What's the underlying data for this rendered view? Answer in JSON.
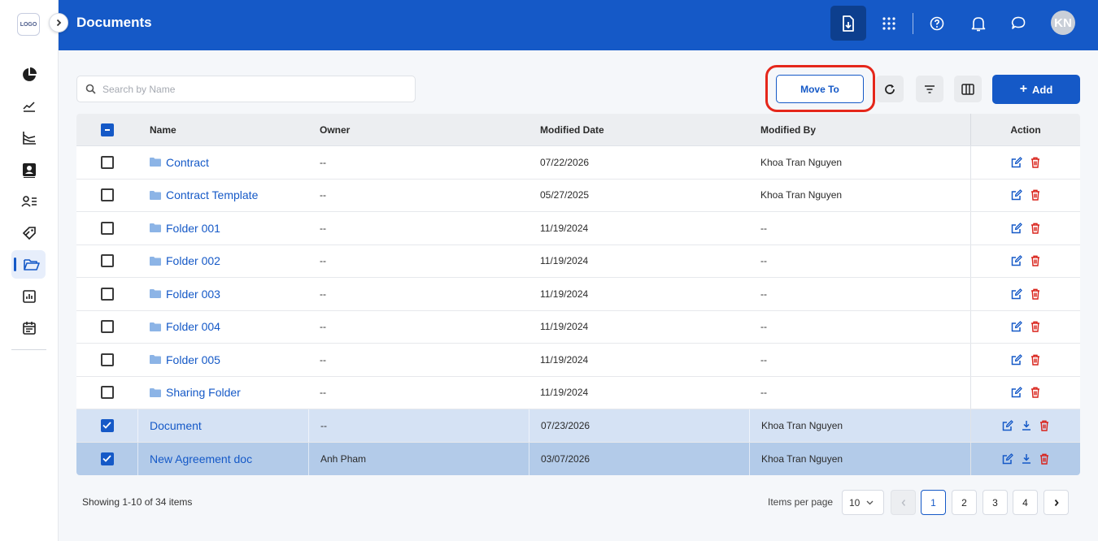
{
  "app": {
    "logo_text": "LOGO",
    "page_title": "Documents",
    "avatar_initials": "KN"
  },
  "colors": {
    "brand": "#1559c7",
    "danger": "#d9221a",
    "highlight_ring": "#e5271b"
  },
  "sidebar": {
    "items": [
      {
        "icon": "pie-chart-icon"
      },
      {
        "icon": "trend-line-icon"
      },
      {
        "icon": "chart-axes-icon"
      },
      {
        "icon": "contact-card-icon"
      },
      {
        "icon": "user-list-icon"
      },
      {
        "icon": "tags-icon"
      },
      {
        "icon": "folder-open-icon",
        "active": true
      },
      {
        "icon": "bar-report-icon"
      },
      {
        "icon": "calendar-icon"
      }
    ]
  },
  "topbar": {
    "icons": [
      "download-doc-icon",
      "apps-grid-icon",
      "help-icon",
      "bell-icon",
      "chat-icon"
    ]
  },
  "toolbar": {
    "search_placeholder": "Search by Name",
    "move_to_label": "Move To",
    "add_label": "Add",
    "icons": [
      "refresh-icon",
      "filter-icon",
      "columns-icon"
    ]
  },
  "table": {
    "headers": {
      "name": "Name",
      "owner": "Owner",
      "modified_date": "Modified Date",
      "modified_by": "Modified By",
      "action": "Action"
    },
    "rows": [
      {
        "name": "Contract",
        "type": "folder",
        "owner": "--",
        "modified_date": "07/22/2026",
        "modified_by": "Khoa Tran Nguyen",
        "checked": false
      },
      {
        "name": "Contract Template",
        "type": "folder",
        "owner": "--",
        "modified_date": "05/27/2025",
        "modified_by": "Khoa Tran Nguyen",
        "checked": false
      },
      {
        "name": "Folder 001",
        "type": "folder",
        "owner": "--",
        "modified_date": "11/19/2024",
        "modified_by": "--",
        "checked": false
      },
      {
        "name": "Folder 002",
        "type": "folder",
        "owner": "--",
        "modified_date": "11/19/2024",
        "modified_by": "--",
        "checked": false
      },
      {
        "name": "Folder 003",
        "type": "folder",
        "owner": "--",
        "modified_date": "11/19/2024",
        "modified_by": "--",
        "checked": false
      },
      {
        "name": "Folder 004",
        "type": "folder",
        "owner": "--",
        "modified_date": "11/19/2024",
        "modified_by": "--",
        "checked": false
      },
      {
        "name": "Folder 005",
        "type": "folder",
        "owner": "--",
        "modified_date": "11/19/2024",
        "modified_by": "--",
        "checked": false
      },
      {
        "name": "Sharing Folder",
        "type": "folder",
        "owner": "--",
        "modified_date": "11/19/2024",
        "modified_by": "--",
        "checked": false
      },
      {
        "name": "Document",
        "type": "file",
        "owner": "--",
        "modified_date": "07/23/2026",
        "modified_by": "Khoa Tran Nguyen",
        "checked": true
      },
      {
        "name": "New Agreement doc",
        "type": "file",
        "owner": "Anh Pham",
        "modified_date": "03/07/2026",
        "modified_by": "Khoa Tran Nguyen",
        "checked": true
      }
    ]
  },
  "pagination": {
    "showing": "Showing 1-10 of 34 items",
    "items_per_page_label": "Items per page",
    "items_per_page": "10",
    "pages": [
      "1",
      "2",
      "3",
      "4"
    ],
    "current_page": "1"
  }
}
